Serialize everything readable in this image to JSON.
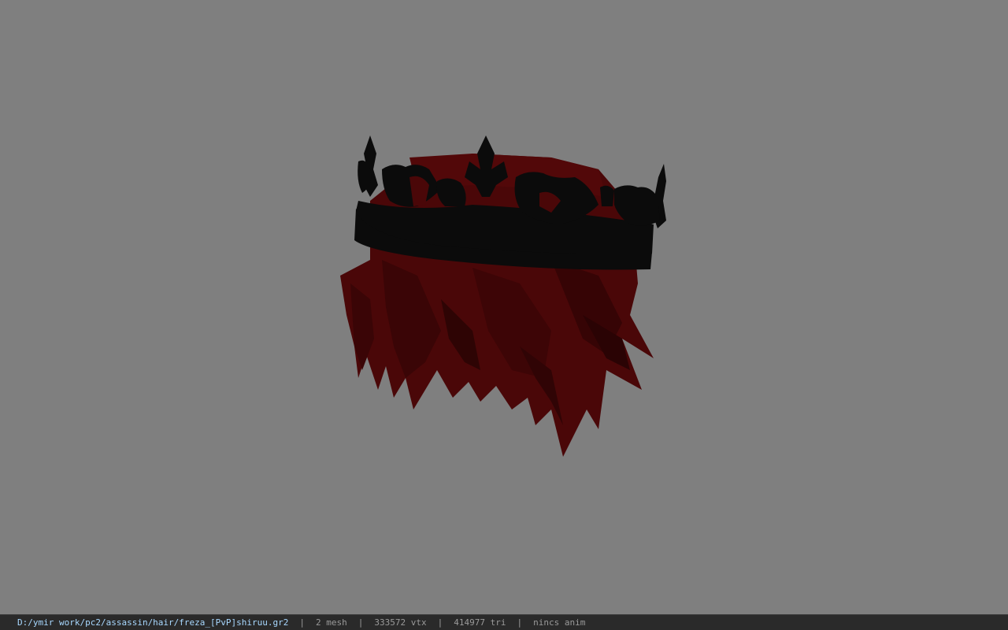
{
  "viewer": {
    "background_color": "#7f7f7f",
    "model": {
      "subject": "red spiky hair with black crown",
      "hair_color": "#4a0708",
      "hair_shadow_color": "#300405",
      "crown_color": "#0b0b0b"
    }
  },
  "statusbar": {
    "path": "D:/ymir work/pc2/assassin/hair/freza_[PvP]shiruu.gr2",
    "separator": "|",
    "mesh": "2 mesh",
    "vtx": "333572 vtx",
    "tri": "414977 tri",
    "anim": "nincs anim"
  }
}
